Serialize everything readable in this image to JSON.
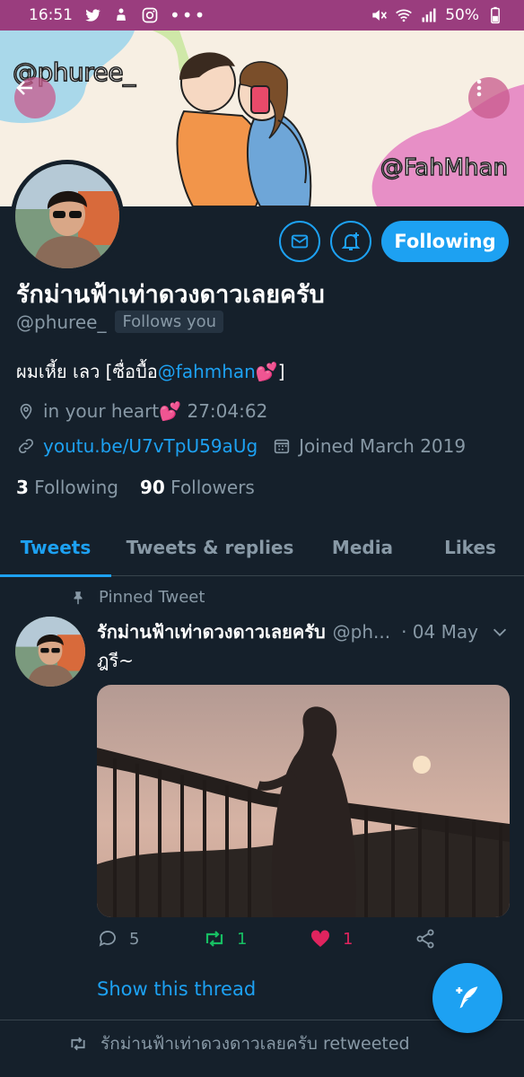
{
  "status_bar": {
    "time": "16:51",
    "battery": "50%"
  },
  "banner": {
    "handle_left": "@phuree_",
    "handle_right": "@FahMhan"
  },
  "profile": {
    "follow_label": "Following",
    "display_name": "รักม่านฟ้าเท่าดวงดาวเลยครับ",
    "handle": "@phuree_",
    "follows_you": "Follows you",
    "bio_text": "ผมเหี้ย เลว [ซื่อบื้อ",
    "bio_link": "@fahmhan",
    "bio_end": "💕]",
    "location": "in your heart💕 27:04:62",
    "url": "youtu.be/U7vTpU59aUg",
    "joined": "Joined March 2019",
    "following_count": "3",
    "following_label": "Following",
    "followers_count": "90",
    "followers_label": "Followers"
  },
  "tabs": [
    {
      "label": "Tweets",
      "active": true
    },
    {
      "label": "Tweets & replies",
      "active": false
    },
    {
      "label": "Media",
      "active": false
    },
    {
      "label": "Likes",
      "active": false
    }
  ],
  "tweet": {
    "pinned_label": "Pinned Tweet",
    "name": "รักม่านฟ้าเท่าดวงดาวเลยครับ",
    "handle": "@ph...",
    "date": "· 04 May",
    "text": "ฎรี~",
    "replies": "5",
    "retweets": "1",
    "likes": "1",
    "show_thread": "Show this thread"
  },
  "next_item": {
    "retweeted_by": "รักม่านฟ้าเท่าดวงดาวเลยครับ retweeted"
  },
  "colors": {
    "accent": "#1da1f2",
    "background": "#15202b",
    "status_bar": "#9a3d7e",
    "like": "#e0245e",
    "retweet": "#17bf63"
  }
}
